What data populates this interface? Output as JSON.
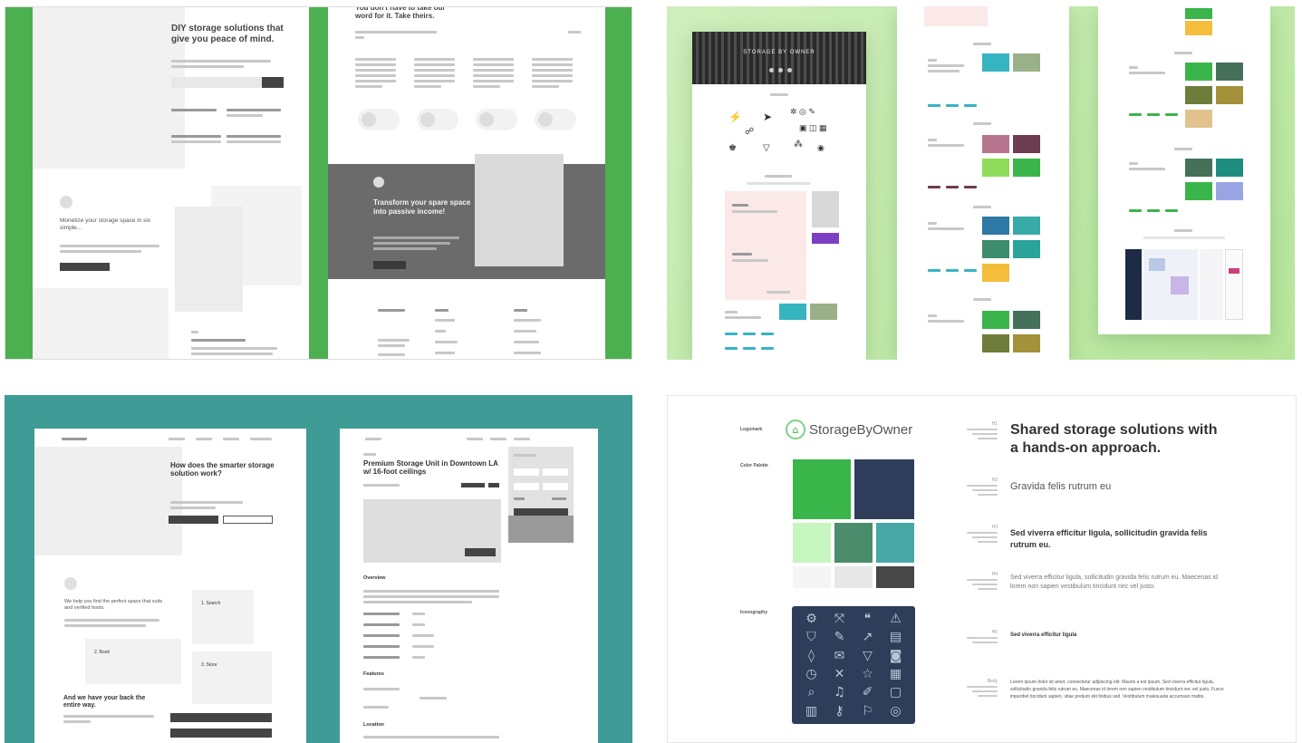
{
  "tile1": {
    "hero_title": "DIY storage solutions that give you peace of mind.",
    "quote_title": "You don't have to take our word for it. Take theirs.",
    "mid_text": "Monetize your storage space in six simple...",
    "dark_title": "Transform your spare space into passive income!"
  },
  "tile2": {
    "hero_banner": "STORAGE BY OWNER"
  },
  "tile3": {
    "hero_title": "How does the smarter storage solution work?",
    "mid_text": "We help you find the perfect space that suits and verified hosts.",
    "card_search": "1. Search",
    "card_book": "2. Book",
    "card_store": "3. Store",
    "back_title": "And we have your back the entire way.",
    "listing_title": "Premium Storage Unit in Downtown LA w/ 16-foot ceilings",
    "section_overview": "Overview",
    "section_features": "Features",
    "section_location": "Location"
  },
  "tile4": {
    "logomark_label": "Logomark",
    "logo_text": "StorageByOwner",
    "color_label": "Color Palette",
    "icon_label": "Iconography",
    "colors": {
      "green": "#3ab54a",
      "navy": "#2e3d59",
      "light_green": "#c6f5c0",
      "sea_green": "#4b8c6c",
      "teal": "#48a8a6",
      "off_white": "#f5f5f5",
      "light_gray": "#e8e8e8",
      "charcoal": "#474747",
      "icon_panel": "#2e3d59"
    },
    "type": {
      "h1": "Shared storage solutions with a hands-on approach.",
      "h2": "Gravida felis rutrum eu",
      "h3": "Sed viverra efficitur ligula, sollicitudin gravida felis rutrum eu.",
      "h4": "Sed viverra efficitur ligula, sollicitudin gravida felis rutrum eu. Maecenas id lorem non sapien vestibulum tincidunt nec vel justo.",
      "h5": "Sed viverra efficitur ligula",
      "body": "Lorem ipsum dolor sit amet, consectetur adipiscing elit. Mauris a est ipsum. Sed viverra efficitur ligula, sollicitudin gravida felis rutrum eu. Maecenas id lorem non sapien vestibulum tincidunt nec vel justo. Fusce imperdiet tincidunt sapien, vitae pretium elit finibus sed. Vestibulum malesuada accumsan mattis."
    },
    "type_labels": {
      "h1": "H1",
      "h2": "H2",
      "h3": "H3",
      "h4": "H4",
      "h5": "H5",
      "body": "Body"
    }
  }
}
